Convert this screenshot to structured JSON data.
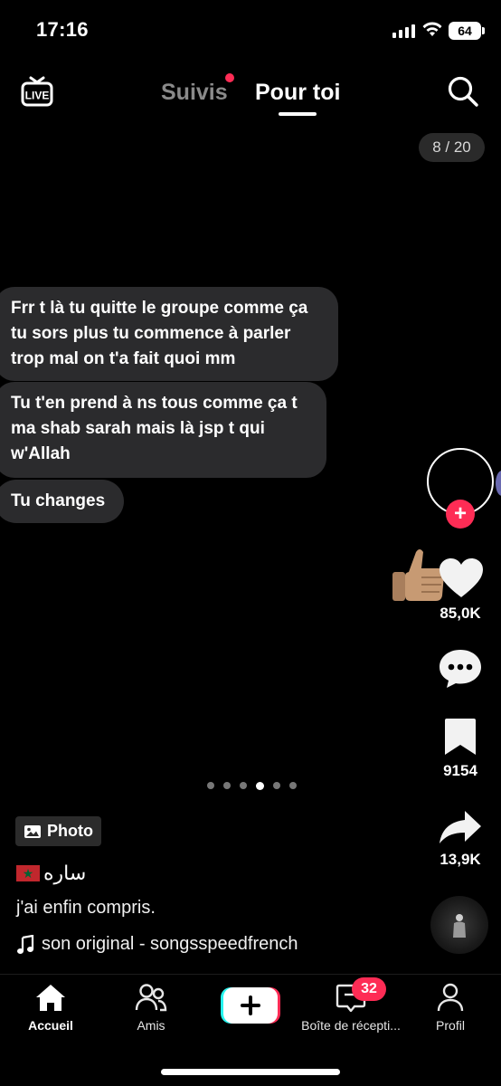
{
  "status_bar": {
    "time": "17:16",
    "battery": "64"
  },
  "header": {
    "live_label": "LIVE",
    "tabs": [
      {
        "label": "Suivis",
        "active": false,
        "has_dot": true
      },
      {
        "label": "Pour toi",
        "active": true
      }
    ],
    "counter": "8 / 20"
  },
  "messages": [
    {
      "lines": [
        "Frr t là tu quitte le groupe comme ça",
        "tu sors plus tu commence à parler",
        "trop mal on t'a fait quoi mm"
      ]
    },
    {
      "lines": [
        "Tu t'en prend à ns tous comme ça t",
        "ma shab sarah mais là jsp t qui",
        "w'Allah"
      ]
    },
    {
      "lines": [
        "Tu changes"
      ]
    }
  ],
  "rail": {
    "likes": "85,0K",
    "bookmarks": "9154",
    "shares": "13,9K"
  },
  "carousel": {
    "count": 6,
    "active_index": 3
  },
  "caption": {
    "photo_tag": "Photo",
    "author": "ساره",
    "description": "j'ai enfin compris.",
    "sound": "son original - songsspeedfrench"
  },
  "nav": {
    "home": "Accueil",
    "friends": "Amis",
    "inbox": "Boîte de récepti...",
    "inbox_badge": "32",
    "profile": "Profil"
  },
  "colors": {
    "accent": "#fe2c55",
    "bubble": "#2b2b2d",
    "background": "#000000"
  }
}
